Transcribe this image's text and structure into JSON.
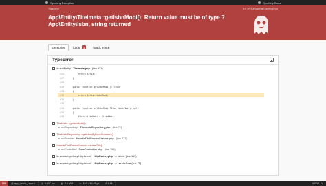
{
  "topbar": {
    "brand": "Symfony Exception",
    "docs": "Symfony Docs"
  },
  "hero": {
    "error_class": "TypeError",
    "http_status": "HTTP 500 Internal Server Error",
    "message": "App\\Entity\\Titelmeta::getIsbnMobi(): Return value must be of type ?App\\Entity\\Isbn, string returned"
  },
  "tabs": [
    {
      "label": "Exception"
    },
    {
      "label": "Logs",
      "badge": "1"
    },
    {
      "label": "Stack Trace"
    }
  ],
  "panel": {
    "title": "TypeError",
    "frame1_path": "in src/Entity/",
    "frame1_file": "Titelmeta.php",
    "frame1_line": "(line 631)",
    "code": [
      {
        "n": "626",
        "t": "        return $this;"
      },
      {
        "n": "627",
        "t": "    }"
      },
      {
        "n": "628",
        "t": ""
      },
      {
        "n": "629",
        "t": "    public function getIsbnMobi(): ?Isbn"
      },
      {
        "n": "630",
        "t": "    {"
      },
      {
        "n": "631",
        "t": "        return $this->isbnMobi;"
      },
      {
        "n": "632",
        "t": "    }"
      },
      {
        "n": "633",
        "t": ""
      },
      {
        "n": "634",
        "t": "    public function setIsbnMobi(?Isbn $isbnMobi): self"
      },
      {
        "n": "635",
        "t": "    {"
      },
      {
        "n": "636",
        "t": "        $this->isbnMobi = $isbnMobi;"
      }
    ],
    "frames": [
      {
        "fn": "Titelmeta->getIsbnMobi()",
        "path": "in src/Repository/",
        "file": "TitelmetaRepository.php",
        "line": "(line 71)"
      },
      {
        "fn": "TitelmetaRepository->getIsbnsByBookNumbers()",
        "path": "in src/Service/",
        "file": "HandleTitelEntriesService.php",
        "line": "(line 277)"
      },
      {
        "fn": "HandleTitelEntriesService->deleteTitle()",
        "path": "in src/Controller/",
        "file": "DataController.php",
        "line": "(line 155)"
      },
      {
        "fn": "",
        "path": "in vendor/symfony/http-kernel/",
        "file": "HttpKernel.php",
        "line": "-> delete (line 163)"
      },
      {
        "fn": "",
        "path": "in vendor/symfony/http-kernel/",
        "file": "HttpKernel.php",
        "line": "-> handleRaw (line 75)"
      }
    ]
  },
  "statusbar": {
    "code": "500",
    "route": "@ app_delete_record",
    "time": "6,837 ms",
    "memory": "2.0 MiB",
    "viewport": "240 × 24.45 px",
    "php": "8.1.14",
    "version": "6.2.10"
  },
  "colors": {
    "accent": "#b0413e",
    "dark": "#222222",
    "highlight": "#fce9b8"
  }
}
